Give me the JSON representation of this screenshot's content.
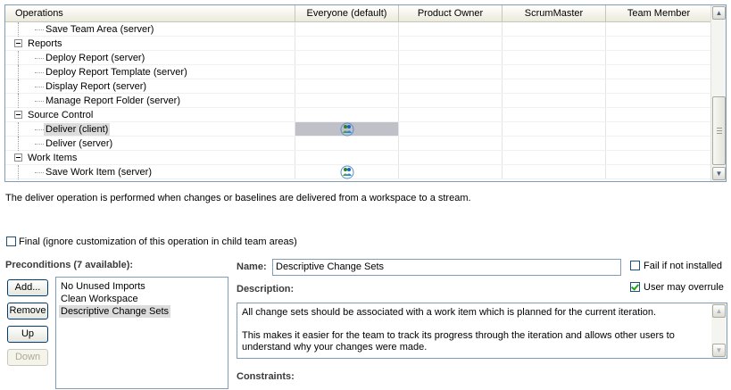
{
  "table": {
    "columns": [
      "Operations",
      "Everyone (default)",
      "Product Owner",
      "ScrumMaster",
      "Team Member"
    ],
    "rows": [
      {
        "label": "Save Team Area (server)",
        "level": 1,
        "icon_col": null,
        "selected": false
      },
      {
        "label": "Reports",
        "level": 0,
        "icon_col": null,
        "selected": false
      },
      {
        "label": "Deploy Report (server)",
        "level": 1,
        "icon_col": null,
        "selected": false
      },
      {
        "label": "Deploy Report Template (server)",
        "level": 1,
        "icon_col": null,
        "selected": false
      },
      {
        "label": "Display Report (server)",
        "level": 1,
        "icon_col": null,
        "selected": false
      },
      {
        "label": "Manage Report Folder (server)",
        "level": 1,
        "icon_col": null,
        "selected": false
      },
      {
        "label": "Source Control",
        "level": 0,
        "icon_col": null,
        "selected": false
      },
      {
        "label": "Deliver (client)",
        "level": 1,
        "icon_col": 1,
        "selected": true
      },
      {
        "label": "Deliver (server)",
        "level": 1,
        "icon_col": null,
        "selected": false
      },
      {
        "label": "Work Items",
        "level": 0,
        "icon_col": null,
        "selected": false
      },
      {
        "label": "Save Work Item (server)",
        "level": 1,
        "icon_col": 1,
        "selected": false
      }
    ],
    "permission_icon": "team-members-icon",
    "scroll_up_icon": "scroll-up-arrow-icon",
    "scroll_down_icon": "scroll-down-arrow-icon"
  },
  "operation_description": "The deliver operation is performed when changes or baselines are delivered from a workspace to a stream.",
  "final_checkbox": {
    "label": "Final (ignore customization of this operation in child team areas)",
    "checked": false
  },
  "preconditions": {
    "heading": "Preconditions (7 available):",
    "buttons": {
      "add": "Add...",
      "remove": "Remove",
      "up": "Up",
      "down": "Down"
    },
    "items": [
      "No Unused Imports",
      "Clean Workspace",
      "Descriptive Change Sets"
    ],
    "selected_index": 2
  },
  "details": {
    "name_label": "Name:",
    "name_value": "Descriptive Change Sets",
    "fail_if_not_installed": {
      "label": "Fail if not installed",
      "checked": false
    },
    "user_may_overrule": {
      "label": "User may overrule",
      "checked": true
    },
    "description_label": "Description:",
    "description_text": "All change sets should be associated with a work item which is planned for the current iteration.\n\nThis makes it easier for the team to track its progress through the iteration and allows other users to understand why your changes were made.",
    "constraints_label": "Constraints:"
  },
  "colors": {
    "border": "#7f9db9",
    "selection": "#c0c0c8",
    "button_border": "#003c74"
  }
}
